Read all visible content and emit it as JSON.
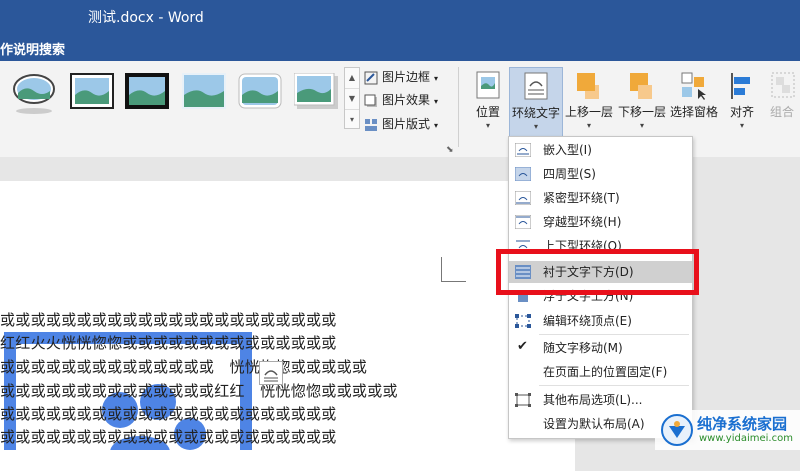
{
  "window": {
    "title": "测试.docx  -  Word"
  },
  "menubar": {
    "tell_me": "作说明搜索"
  },
  "picture_styles": {
    "border_label": "图片边框",
    "effects_label": "图片效果",
    "layout_label": "图片版式"
  },
  "arrange": {
    "position_label": "位置",
    "wrap_text_label": "环绕文字",
    "bring_forward_label": "上移一层",
    "send_backward_label": "下移一层",
    "selection_pane_label": "选择窗格",
    "align_label": "对齐",
    "group_label": "组合"
  },
  "wrap_menu": {
    "items": [
      {
        "label": "嵌入型(I)"
      },
      {
        "label": "四周型(S)"
      },
      {
        "label": "紧密型环绕(T)"
      },
      {
        "label": "穿越型环绕(H)"
      },
      {
        "label": "上下型环绕(O)"
      },
      {
        "label": "衬于文字下方(D)"
      },
      {
        "label": "浮于文字上方(N)"
      },
      {
        "label": "编辑环绕顶点(E)"
      },
      {
        "label": "随文字移动(M)"
      },
      {
        "label": "在页面上的位置固定(F)"
      },
      {
        "label": "其他布局选项(L)..."
      },
      {
        "label": "设置为默认布局(A)"
      }
    ]
  },
  "document": {
    "lines": [
      "或或或或或或或或或或或或或或或或或或或或或或",
      "红红火火恍恍惚惚或或或或或或或或或或或或或或",
      "或或或或或或或或或或或或或或　恍恍惚惚或或或或或",
      "或或或或或或或或或或或或或或红红　恍恍惚惚或或或或或",
      "或或或或或或或或或或或或或或或或或或或或或或",
      "或或或或或或或或或或或或或或或或或或或或或或",
      "或或或红红火火恍恍惚惚或或或或或或或或或或或或"
    ]
  },
  "watermark": {
    "name": "纯净系统家园",
    "url": "www.yidaimei.com"
  },
  "colors": {
    "titlebar": "#2b579a",
    "highlight_box": "#e8101b",
    "accent_blue": "#2f6fe0"
  }
}
